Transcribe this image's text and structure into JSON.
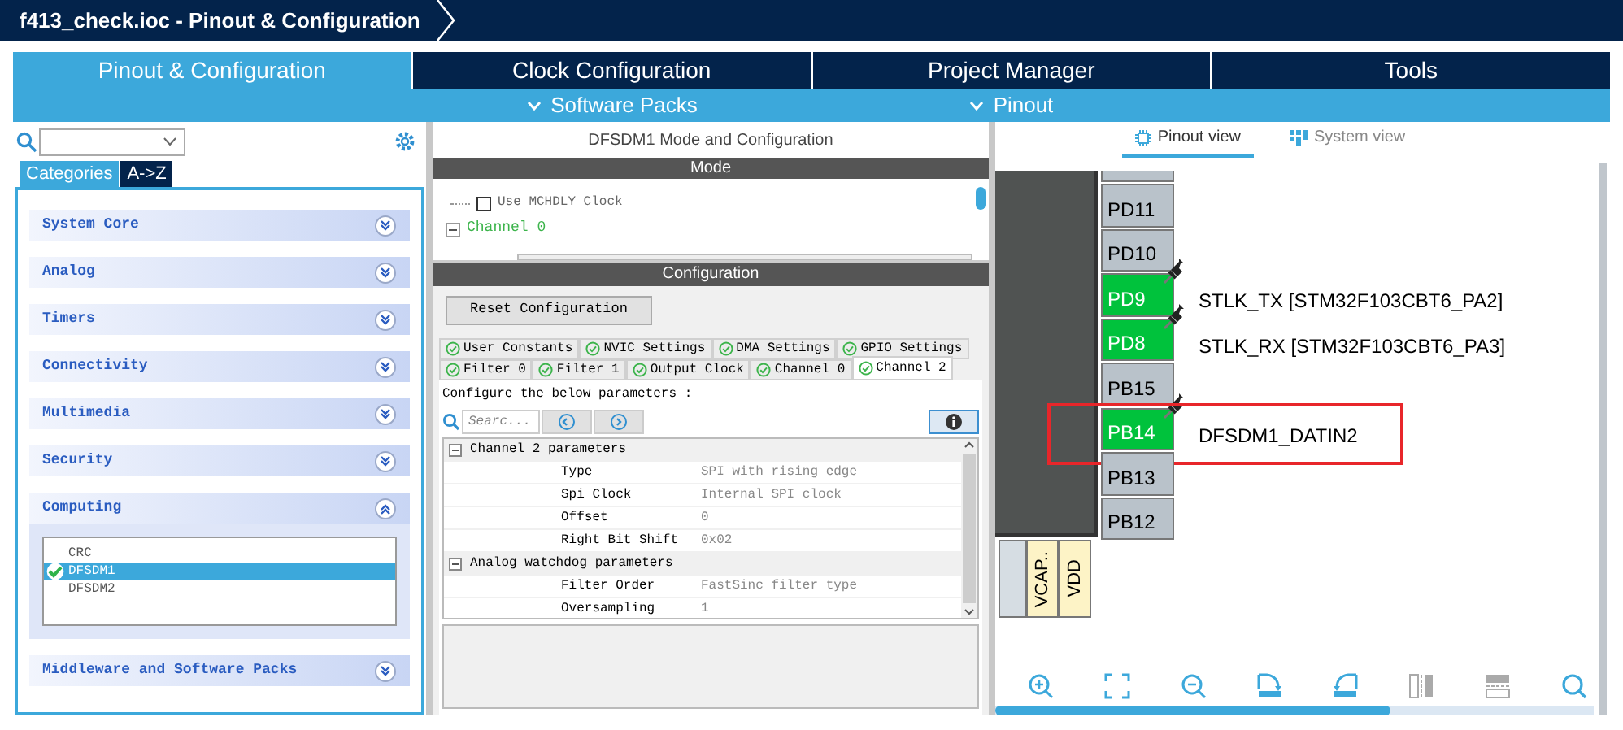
{
  "window": {
    "title": "f413_check.ioc - Pinout & Configuration"
  },
  "main_tabs": [
    {
      "label": "Pinout & Configuration",
      "selected": true
    },
    {
      "label": "Clock Configuration",
      "selected": false
    },
    {
      "label": "Project Manager",
      "selected": false
    },
    {
      "label": "Tools",
      "selected": false
    }
  ],
  "sub_menus": [
    "Software Packs",
    "Pinout"
  ],
  "left_panel": {
    "view_tabs": [
      {
        "label": "Categories",
        "selected": true
      },
      {
        "label": "A->Z",
        "selected": false
      }
    ],
    "categories": [
      {
        "label": "System Core",
        "expanded": false
      },
      {
        "label": "Analog",
        "expanded": false
      },
      {
        "label": "Timers",
        "expanded": false
      },
      {
        "label": "Connectivity",
        "expanded": false
      },
      {
        "label": "Multimedia",
        "expanded": false
      },
      {
        "label": "Security",
        "expanded": false
      },
      {
        "label": "Computing",
        "expanded": true,
        "items": [
          {
            "label": "CRC",
            "selected": false,
            "checked": false
          },
          {
            "label": "DFSDM1",
            "selected": true,
            "checked": true
          },
          {
            "label": "DFSDM2",
            "selected": false,
            "checked": false
          }
        ]
      },
      {
        "label": "Middleware and Software Packs",
        "expanded": false
      }
    ]
  },
  "middle_panel": {
    "title": "DFSDM1 Mode and Configuration",
    "mode": {
      "header": "Mode",
      "tree": [
        {
          "kind": "checkbox",
          "label": "Use_MCHDLY_Clock",
          "checked": false
        },
        {
          "kind": "node",
          "label": "Channel 0"
        }
      ]
    },
    "configuration": {
      "header": "Configuration",
      "reset_button": "Reset Configuration",
      "tab_rows": [
        [
          {
            "label": "User Constants",
            "selected": false
          },
          {
            "label": "NVIC Settings",
            "selected": false
          },
          {
            "label": "DMA Settings",
            "selected": false
          },
          {
            "label": "GPIO Settings",
            "selected": false
          }
        ],
        [
          {
            "label": "Filter 0",
            "selected": false
          },
          {
            "label": "Filter 1",
            "selected": false
          },
          {
            "label": "Output Clock",
            "selected": false
          },
          {
            "label": "Channel 0",
            "selected": false
          },
          {
            "label": "Channel 2",
            "selected": true
          }
        ]
      ],
      "instruction": "Configure the below parameters :",
      "search": {
        "placeholder": "Searc..."
      },
      "groups": [
        {
          "title": "Channel 2 parameters",
          "params": [
            {
              "name": "Type",
              "value": "SPI with rising edge"
            },
            {
              "name": "Spi Clock",
              "value": "Internal SPI clock"
            },
            {
              "name": "Offset",
              "value": "0"
            },
            {
              "name": "Right Bit Shift",
              "value": "0x02"
            }
          ]
        },
        {
          "title": "Analog watchdog parameters",
          "params": [
            {
              "name": "Filter Order",
              "value": "FastSinc filter type"
            },
            {
              "name": "Oversampling",
              "value": "1"
            }
          ]
        }
      ]
    }
  },
  "pinout": {
    "view_tabs": [
      {
        "label": "Pinout view",
        "selected": true
      },
      {
        "label": "System view",
        "selected": false
      }
    ],
    "pins": [
      {
        "label": "PD11",
        "assigned": false,
        "pinned": false
      },
      {
        "label": "PD10",
        "assigned": false,
        "pinned": false
      },
      {
        "label": "PD9",
        "assigned": true,
        "pinned": true,
        "signal": "STLK_TX [STM32F103CBT6_PA2]"
      },
      {
        "label": "PD8",
        "assigned": true,
        "pinned": true,
        "signal": "STLK_RX [STM32F103CBT6_PA3]"
      },
      {
        "label": "PB15",
        "assigned": false,
        "pinned": false
      },
      {
        "label": "PB14",
        "assigned": true,
        "pinned": true,
        "signal": "DFSDM1_DATIN2",
        "highlighted": true
      },
      {
        "label": "PB13",
        "assigned": false,
        "pinned": false
      },
      {
        "label": "PB12",
        "assigned": false,
        "pinned": false
      }
    ],
    "bottom_pins": [
      {
        "label": "VCAP.."
      },
      {
        "label": "VDD"
      }
    ]
  }
}
